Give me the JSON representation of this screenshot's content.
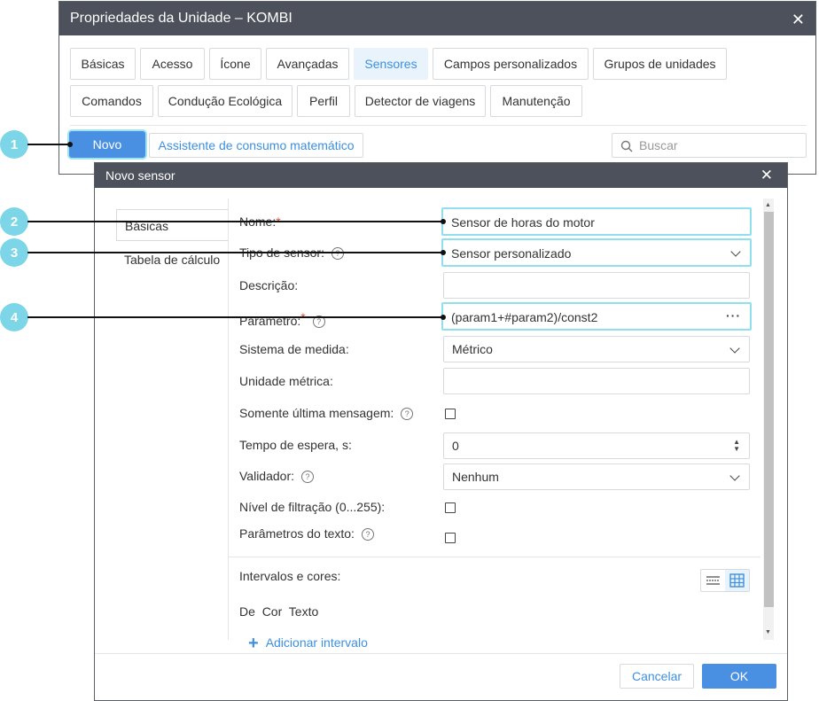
{
  "window": {
    "title": "Propriedades da Unidade – KOMBI",
    "tabs_row1": [
      "Básicas",
      "Acesso",
      "Ícone",
      "Avançadas",
      "Sensores",
      "Campos personalizados",
      "Grupos de unidades"
    ],
    "tabs_row2": [
      "Comandos",
      "Condução Ecológica",
      "Perfil",
      "Detector de viagens",
      "Manutenção"
    ],
    "active_tab": "Sensores",
    "new_button": "Novo",
    "assistant_button": "Assistente de consumo matemático",
    "search_placeholder": "Buscar"
  },
  "dialog": {
    "title": "Novo sensor",
    "side_tabs": [
      "Básicas",
      "Tabela de cálculo"
    ],
    "labels": {
      "name": "Nome:",
      "sensor_type": "Tipo de sensor:",
      "description": "Descrição:",
      "parameter": "Parâmetro:",
      "measure_system": "Sistema de medida:",
      "metric_unit": "Unidade métrica:",
      "last_message_only": "Somente última mensagem:",
      "timeout": "Tempo de espera, s:",
      "validator": "Validador:",
      "filter_level": "Nível de filtração (0...255):",
      "text_params": "Parâmetros do texto:",
      "intervals_colors": "Intervalos e cores:",
      "col_from": "De",
      "col_color": "Cor",
      "col_text": "Texto",
      "add_interval": "Adicionar intervalo"
    },
    "values": {
      "name": "Sensor de horas do motor",
      "sensor_type": "Sensor personalizado",
      "description": "",
      "parameter": "(param1+#param2)/const2",
      "measure_system": "Métrico",
      "metric_unit": "",
      "timeout": "0",
      "validator": "Nenhum",
      "last_message_only": false,
      "filter_level": false,
      "text_params": false
    },
    "required_mark": "*",
    "help_glyph": "?",
    "cancel_button": "Cancelar",
    "ok_button": "OK"
  },
  "callouts": [
    "1",
    "2",
    "3",
    "4"
  ],
  "colors": {
    "header": "#4c515b",
    "accent": "#4a90e2",
    "callout": "#7dd6e8",
    "highlight_border": "#8fe0ec"
  }
}
